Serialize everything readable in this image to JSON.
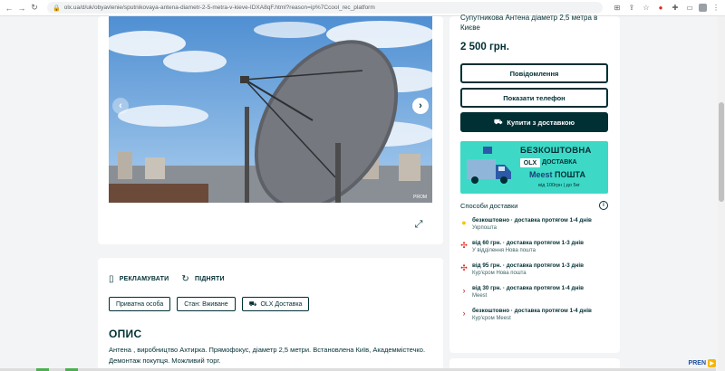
{
  "browser": {
    "url": "olx.ua/d/uk/obyavlenie/sputnikovaya-antena-diametr-2-5-metra-v-kieve-IDXA8qF.html?reason=ip%7Ccool_rec_platform",
    "lock_icon": "lock-icon"
  },
  "gallery": {
    "watermark": "PROM",
    "prev_icon": "chevron-left-icon",
    "next_icon": "chevron-right-icon",
    "fullscreen_icon": "expand-icon"
  },
  "actions": {
    "promote": "РЕКЛАМУВАТИ",
    "raise": "ПІДНЯТИ"
  },
  "tags": [
    "Приватна особа",
    "Стан: Вживане",
    "OLX Доставка"
  ],
  "description": {
    "heading": "ОПИС",
    "text": "Антена , виробництво Ахтирка. Прямофокус, діаметр 2,5 метри. Встановлена Київ, Академмістечко. Демонтаж покупця. Можливий торг."
  },
  "listing": {
    "title": "Супутникова Антена діаметр 2,5 метра в Києве",
    "price": "2 500 грн."
  },
  "buttons": {
    "message": "Повідомлення",
    "phone": "Показати телефон",
    "buy": "Купити з доставкою"
  },
  "promo": {
    "line1": "БЕЗКОШТОВНА",
    "olx": "OLX",
    "line2": "ДОСТАВКА",
    "brand": "Meest",
    "brand2": "ПОШТА",
    "terms": "від 100грн | до 5кг"
  },
  "delivery": {
    "heading": "Способи доставки",
    "methods": [
      {
        "title": "безкоштовно · доставка протягом 1-4 днів",
        "carrier": "Укрпошта",
        "color": "#f9c300"
      },
      {
        "title": "від 60 грн. · доставка протягом 1-3 днів",
        "carrier": "У відділення Нова пошта",
        "color": "#e2231a"
      },
      {
        "title": "від 95 грн. · доставка протягом 1-3 днів",
        "carrier": "Кур'єром Нова пошта",
        "color": "#e2231a"
      },
      {
        "title": "від 30 грн. · доставка протягом 1-4 днів",
        "carrier": "Meest",
        "color": "#c8102e"
      },
      {
        "title": "безкоштовно · доставка протягом 1-4 днів",
        "carrier": "Кур'єром Meest",
        "color": "#c8102e"
      }
    ]
  },
  "overlay_logo": "PREN"
}
